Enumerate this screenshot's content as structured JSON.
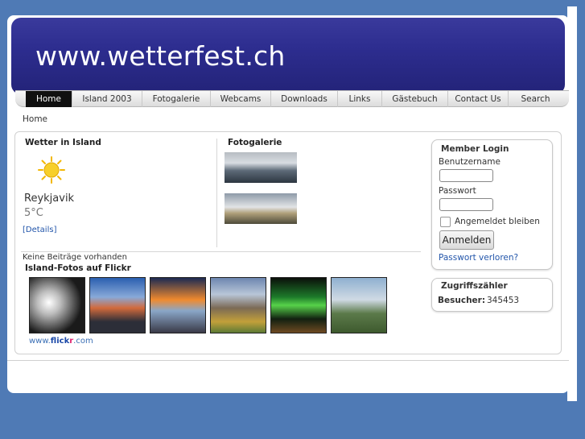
{
  "site": {
    "title": "www.wetterfest.ch"
  },
  "nav": {
    "items": [
      {
        "label": "Home",
        "active": true
      },
      {
        "label": "Island 2003"
      },
      {
        "label": "Fotogalerie"
      },
      {
        "label": "Webcams"
      },
      {
        "label": "Downloads"
      },
      {
        "label": "Links"
      },
      {
        "label": "Gästebuch"
      },
      {
        "label": "Contact Us"
      },
      {
        "label": "Search"
      }
    ]
  },
  "breadcrumb": "Home",
  "weather": {
    "title": "Wetter in Island",
    "city": "Reykjavik",
    "temperature": "5°C",
    "details_link": "[Details]",
    "icon": "sun-icon"
  },
  "gallery": {
    "title": "Fotogalerie"
  },
  "posts": {
    "empty_text": "Keine Beiträge vorhanden"
  },
  "flickr": {
    "title": "Island-Fotos auf Flickr",
    "link_prefix": "www.",
    "link_brand_a": "flick",
    "link_brand_b": "r",
    "link_suffix": ".com"
  },
  "login": {
    "title": "Member Login",
    "username_label": "Benutzername",
    "password_label": "Passwort",
    "remember_label": "Angemeldet bleiben",
    "submit_label": "Anmelden",
    "forgot_link": "Passwort verloren?"
  },
  "counter": {
    "title": "Zugriffszähler",
    "label": "Besucher:",
    "value": "345453"
  },
  "colors": {
    "background": "#4f7ab5",
    "banner": "#2d2d8f",
    "link": "#2255aa"
  }
}
